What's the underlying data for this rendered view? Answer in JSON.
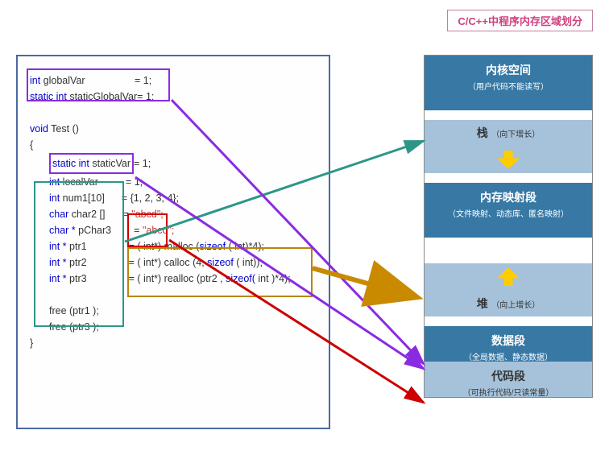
{
  "title": "C/C++中程序内存区域划分",
  "code": {
    "l1a": "int",
    "l1b": " globalVar",
    "l1c": " = 1;",
    "l2a": "static int",
    "l2b": " staticGlobalVar",
    "l2c": "= 1;",
    "l4a": "void",
    "l4b": " Test ()",
    "l5": "{",
    "l6a": "static int",
    "l6b": " staticVar",
    "l6c": "= 1;",
    "l7a": "int",
    "l7b": " localVar",
    "l7c": "= 1;",
    "l8a": "int",
    "l8b": " num1[10]",
    "l8c": "= {1, 2, 3, 4};",
    "l9a": "char",
    "l9b": " char2 []",
    "l9c": "=",
    "l9d": "\"abcd\";",
    "l10a": "char *",
    "l10b": " pChar3",
    "l10c": "=",
    "l10d": "\"abcd\";",
    "l11a": "int *",
    "l11b": " ptr1",
    "l11c": "= (",
    "l11d": " int*) malloc (",
    "l11e": "sizeof",
    "l11f": " ( int)*4);",
    "l12a": "int *",
    "l12b": " ptr2",
    "l12c": "= ( int*) calloc (4, ",
    "l12d": "sizeof",
    "l12e": " ( int));",
    "l13a": "int *",
    "l13b": " ptr3",
    "l13c": "= ( int*) realloc (ptr2 , ",
    "l13d": "sizeof(",
    "l13e": " int )*4);",
    "l15": "free (ptr1 );",
    "l16": "free (ptr3 );",
    "l17": "}"
  },
  "memory": {
    "kernel_title": "内核空间",
    "kernel_sub": "（用户代码不能读写）",
    "stack_title": "栈",
    "stack_sub": "（向下增长）",
    "mmap_title": "内存映射段",
    "mmap_sub": "（文件映射、动态库、匿名映射）",
    "heap_title": "堆",
    "heap_sub": "（向上增长）",
    "data_title": "数据段",
    "data_sub": "（全局数据、静态数据）",
    "code_title": "代码段",
    "code_sub": "（可执行代码/只读常量）"
  }
}
